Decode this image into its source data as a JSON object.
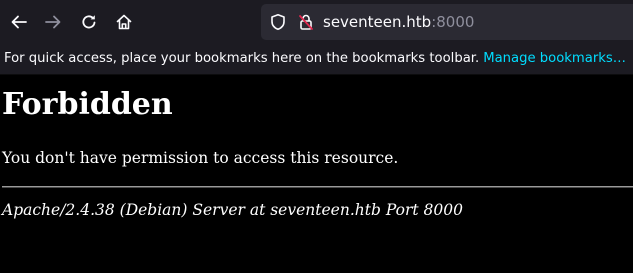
{
  "browser": {
    "back_icon": "back-arrow-icon",
    "forward_icon": "forward-arrow-icon",
    "reload_icon": "reload-icon",
    "home_icon": "home-icon",
    "url_host": "seventeen.htb",
    "url_port": ":8000",
    "tracking_icon": "shield-icon",
    "security_icon": "insecure-lock-icon"
  },
  "bookmarks_bar": {
    "message": "For quick access, place your bookmarks here on the bookmarks toolbar.",
    "manage_link": "Manage bookmarks…"
  },
  "page": {
    "title": "Forbidden",
    "message": "You don't have permission to access this resource.",
    "server_signature": "Apache/2.4.38 (Debian) Server at seventeen.htb Port 8000"
  },
  "colors": {
    "chrome_bg": "#1c1b22",
    "urlbar_bg": "#2b2a33",
    "link": "#00ddff",
    "page_bg": "#000000",
    "page_text": "#ffffff"
  }
}
